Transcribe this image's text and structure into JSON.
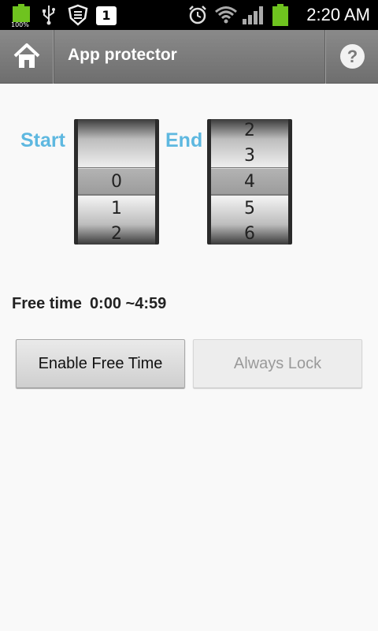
{
  "status_bar": {
    "battery_small_text": "100%",
    "notification_badge": "1",
    "time": "2:20 AM",
    "icons": [
      "battery-icon",
      "usb-icon",
      "shield-icon",
      "notification-icon",
      "alarm-icon",
      "wifi-icon",
      "signal-icon",
      "battery-icon"
    ]
  },
  "action_bar": {
    "title": "App protector",
    "home_icon": "home-icon",
    "help_label": "?"
  },
  "pickers": {
    "start": {
      "label": "Start",
      "values": [
        "",
        "0",
        "1",
        "2"
      ],
      "selected": "0"
    },
    "end": {
      "label": "End",
      "values": [
        "2",
        "3",
        "4",
        "5",
        "6"
      ],
      "selected": "4"
    }
  },
  "free_time": {
    "label": "Free time",
    "value": "0:00 ~4:59"
  },
  "buttons": {
    "enable_free_time": "Enable Free Time",
    "always_lock": "Always Lock"
  },
  "colors": {
    "accent": "#5eb8e0",
    "status_bar_bg": "#000000",
    "action_bar_bg": "#7d7d7d",
    "battery_green": "#6fc31f"
  }
}
